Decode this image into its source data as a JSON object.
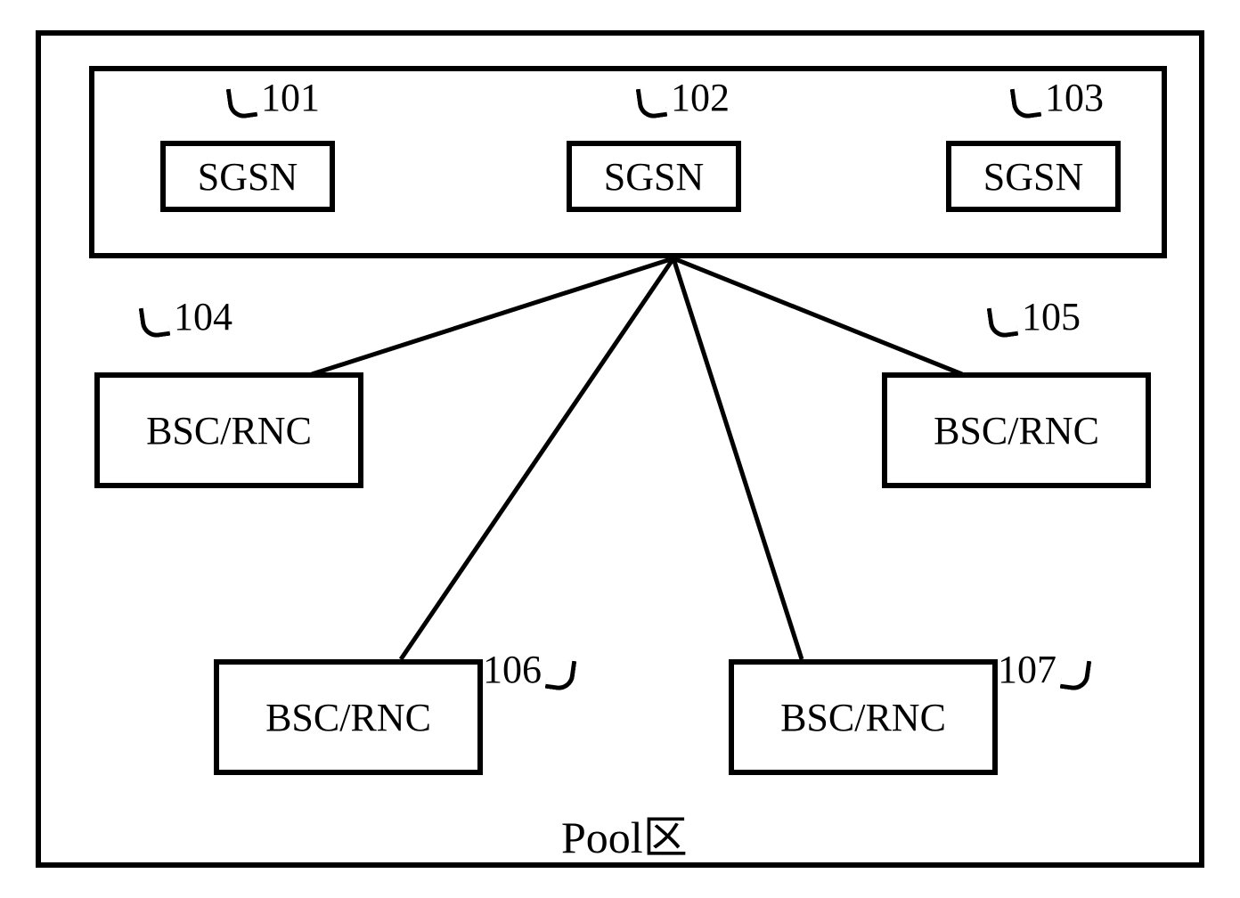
{
  "pool": {
    "label": "Pool区"
  },
  "sgsn": {
    "n101": {
      "ref": "101",
      "label": "SGSN"
    },
    "n102": {
      "ref": "102",
      "label": "SGSN"
    },
    "n103": {
      "ref": "103",
      "label": "SGSN"
    }
  },
  "bscrnc": {
    "n104": {
      "ref": "104",
      "label": "BSC/RNC"
    },
    "n105": {
      "ref": "105",
      "label": "BSC/RNC"
    },
    "n106": {
      "ref": "106",
      "label": "BSC/RNC"
    },
    "n107": {
      "ref": "107",
      "label": "BSC/RNC"
    }
  }
}
